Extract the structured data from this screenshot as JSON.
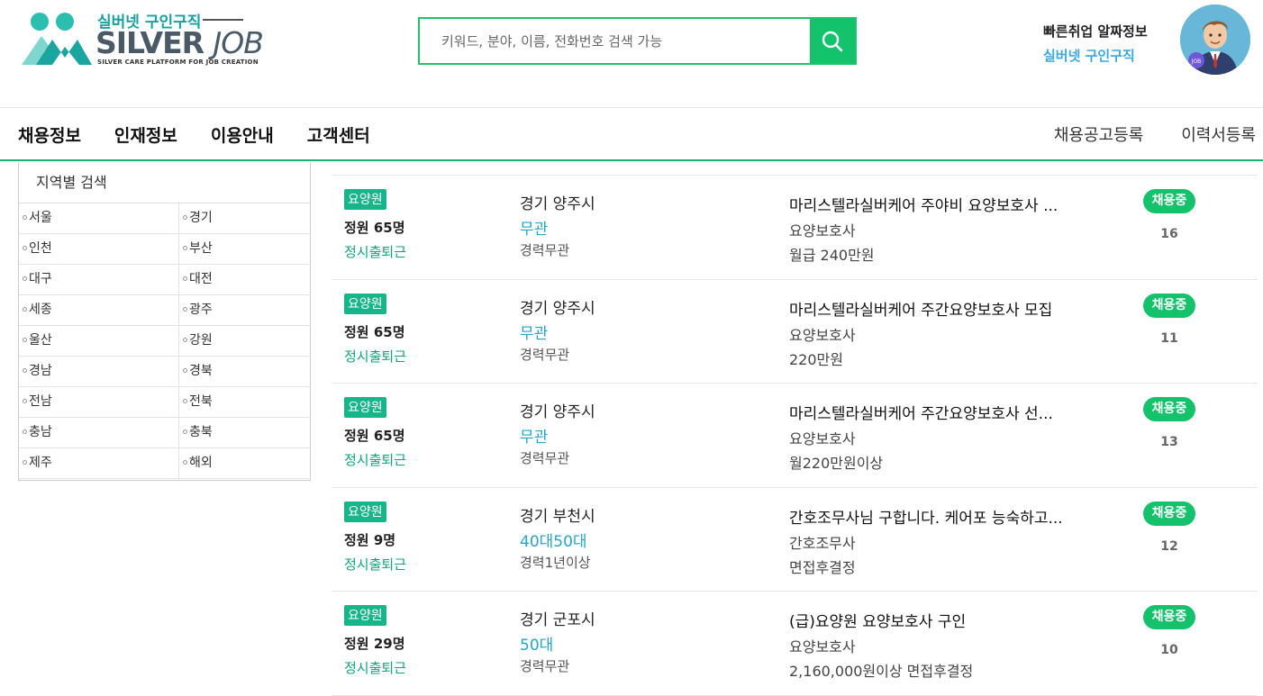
{
  "header": {
    "logo": {
      "top_text": "실버넷 구인구직",
      "big_text_a": "SILVER ",
      "big_text_b": "JOB",
      "tagline": "SILVER CARE PLATFORM FOR JOB CREATION"
    },
    "search": {
      "placeholder": "키워드, 분야, 이름, 전화번호 검색 가능",
      "value": "",
      "icon": "search-icon"
    },
    "quick_info": {
      "line1": "빠른취업 알짜정보",
      "line2": "실버넷 구인구직"
    },
    "avatar": {
      "badge": "JOB"
    }
  },
  "nav": {
    "left": [
      "채용정보",
      "인재정보",
      "이용안내",
      "고객센터"
    ],
    "right": [
      "채용공고등록",
      "이력서등록"
    ]
  },
  "region_search": {
    "title": "지역별 검색",
    "regions": [
      "서울",
      "경기",
      "인천",
      "부산",
      "대구",
      "대전",
      "세종",
      "광주",
      "울산",
      "강원",
      "경남",
      "경북",
      "전남",
      "전북",
      "충남",
      "충북",
      "제주",
      "해외"
    ]
  },
  "listings": [
    {
      "category": "요양원",
      "capacity": "정원 65명",
      "shift": "정시출퇴근",
      "location": "경기 양주시",
      "age": "무관",
      "experience": "경력무관",
      "title": "마리스텔라실버케어 주야비 요양보호사 ...",
      "job": "요양보호사",
      "pay": "월급 240만원",
      "status": "채용중",
      "views": "16"
    },
    {
      "category": "요양원",
      "capacity": "정원 65명",
      "shift": "정시출퇴근",
      "location": "경기 양주시",
      "age": "무관",
      "experience": "경력무관",
      "title": "마리스텔라실버케어 주간요양보호사 모집",
      "job": "요양보호사",
      "pay": "220만원",
      "status": "채용중",
      "views": "11"
    },
    {
      "category": "요양원",
      "capacity": "정원 65명",
      "shift": "정시출퇴근",
      "location": "경기 양주시",
      "age": "무관",
      "experience": "경력무관",
      "title": "마리스텔라실버케어 주간요양보호사 선...",
      "job": "요양보호사",
      "pay": "월220만원이상",
      "status": "채용중",
      "views": "13"
    },
    {
      "category": "요양원",
      "capacity": "정원 9명",
      "shift": "정시출퇴근",
      "location": "경기 부천시",
      "age": "40대50대",
      "experience": "경력1년이상",
      "title": "간호조무사님 구합니다. 케어포 능숙하고...",
      "job": "간호조무사",
      "pay": "면접후결정",
      "status": "채용중",
      "views": "12"
    },
    {
      "category": "요양원",
      "capacity": "정원 29명",
      "shift": "정시출퇴근",
      "location": "경기 군포시",
      "age": "50대",
      "experience": "경력무관",
      "title": "(급)요양원 요양보호사 구인",
      "job": "요양보호사",
      "pay": "2,160,000원이상 면접후결정",
      "status": "채용중",
      "views": "10"
    }
  ],
  "colors": {
    "brand_green": "#13c36b",
    "teal": "#17b58a",
    "sky": "#3aa9e0"
  }
}
